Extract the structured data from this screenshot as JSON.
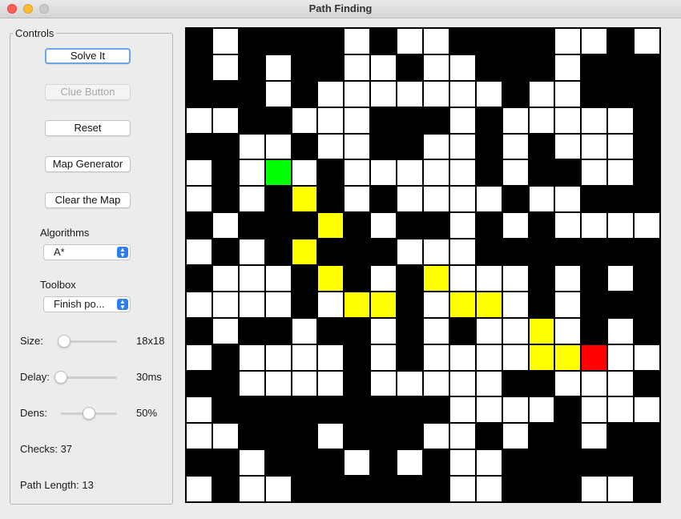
{
  "window": {
    "title": "Path Finding"
  },
  "controls": {
    "legend": "Controls",
    "solve_label": "Solve It",
    "clue_label": "Clue Button",
    "reset_label": "Reset",
    "map_generator_label": "Map Generator",
    "clear_map_label": "Clear the Map",
    "algorithms_label": "Algorithms",
    "algorithm_selected": "A*",
    "toolbox_label": "Toolbox",
    "toolbox_selected": "Finish po...",
    "size_label": "Size:",
    "size_value": "18x18",
    "size_level": 0.06,
    "delay_label": "Delay:",
    "delay_value": "30ms",
    "delay_level": 0.0,
    "dens_label": "Dens:",
    "dens_value": "50%",
    "dens_level": 0.5,
    "checks_text": "Checks: 37",
    "path_length_text": "Path Length: 13"
  },
  "colors": {
    "wall": "#000000",
    "open": "#ffffff",
    "start": "#00ff00",
    "finish": "#ff0000",
    "path": "#ffff00",
    "default_button_focus": "#6ea3e6",
    "select_accent": "#2f7cf6"
  },
  "map": {
    "size": 18,
    "legend": "W = wall, . = open, S = start, F = finish, P = path",
    "rows": [
      "W.WWWW.W..WWWW..W.",
      "W.W.WW..W..WWW.WWW",
      "WWW.W.......W..WWW",
      "..WW...WWW.W.....W",
      "WW..W..WW..W.W...WW",
      ".W.S.W.....W.WW..W.",
      ".W.WPW.W....W..WWW.",
      "W.WWWPW.WW.W.W....",
      ".W.WPWWW...WWWWWWW",
      "W...WPW.WP...W.W.W.",
      "....W.PPW.PP.W.WWW.",
      "W.WW.WW.W.W..P.W.W.",
      ".W....W.W....PPF...",
      "WW....W.....WW...W.",
      ".WWWWWWWWW....W....",
      "..WWW.WWW..W.WW.WW..",
      "WW.WWW.W.W..WWWWWW.",
      ".W..WWWWWW..WWW..WW"
    ]
  }
}
